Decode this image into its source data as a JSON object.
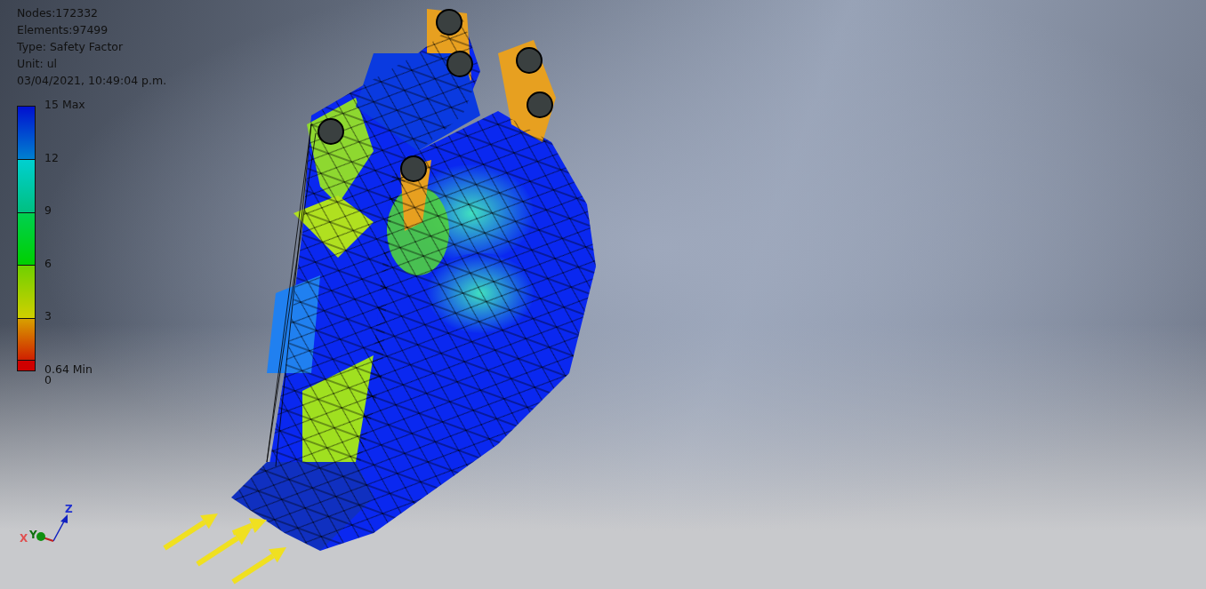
{
  "info_lines": [
    "Nodes:172332",
    "Elements:97499",
    "Type: Safety Factor",
    "Unit: ul",
    "03/04/2021, 10:49:04 p.m."
  ],
  "legend": {
    "labels": [
      {
        "text": "15 Max"
      },
      {
        "text": "12"
      },
      {
        "text": "9"
      },
      {
        "text": "6"
      },
      {
        "text": "3"
      },
      {
        "text": "0.64 Min"
      },
      {
        "text": "0"
      }
    ]
  },
  "triad": {
    "axes": [
      {
        "label": "X",
        "color": "#e05050"
      },
      {
        "label": "Y",
        "color": "#0c6e0c"
      },
      {
        "label": "Z",
        "color": "#2030d0"
      }
    ]
  },
  "loads": [
    {
      "kind": "arrow"
    },
    {
      "kind": "arrow"
    },
    {
      "kind": "arrow"
    },
    {
      "kind": "arrow"
    }
  ]
}
